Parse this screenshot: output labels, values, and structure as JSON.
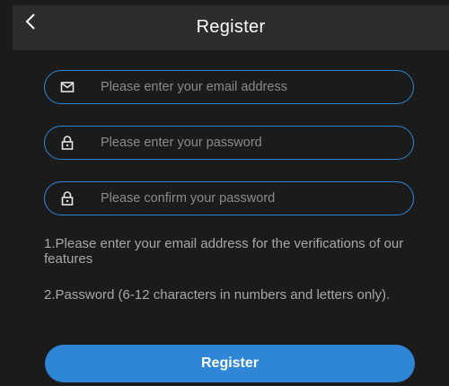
{
  "header": {
    "title": "Register",
    "back_icon": "chevron-left-icon"
  },
  "form": {
    "email": {
      "value": "",
      "placeholder": "Please enter your email address",
      "icon": "mail-icon"
    },
    "password": {
      "value": "",
      "placeholder": "Please enter your password",
      "icon": "lock-icon"
    },
    "confirm_password": {
      "value": "",
      "placeholder": "Please confirm your password",
      "icon": "lock-icon"
    }
  },
  "notes": {
    "note1": "1.Please enter your email address for the verifications of our features",
    "note2": "2.Password (6-12 characters in numbers and letters only)."
  },
  "register_button": {
    "label": "Register"
  },
  "colors": {
    "background": "#1b1b1b",
    "header": "#2d2d2d",
    "accent": "#2f86d6",
    "text_muted": "#a7a7a7",
    "placeholder": "#8a8a8a"
  }
}
